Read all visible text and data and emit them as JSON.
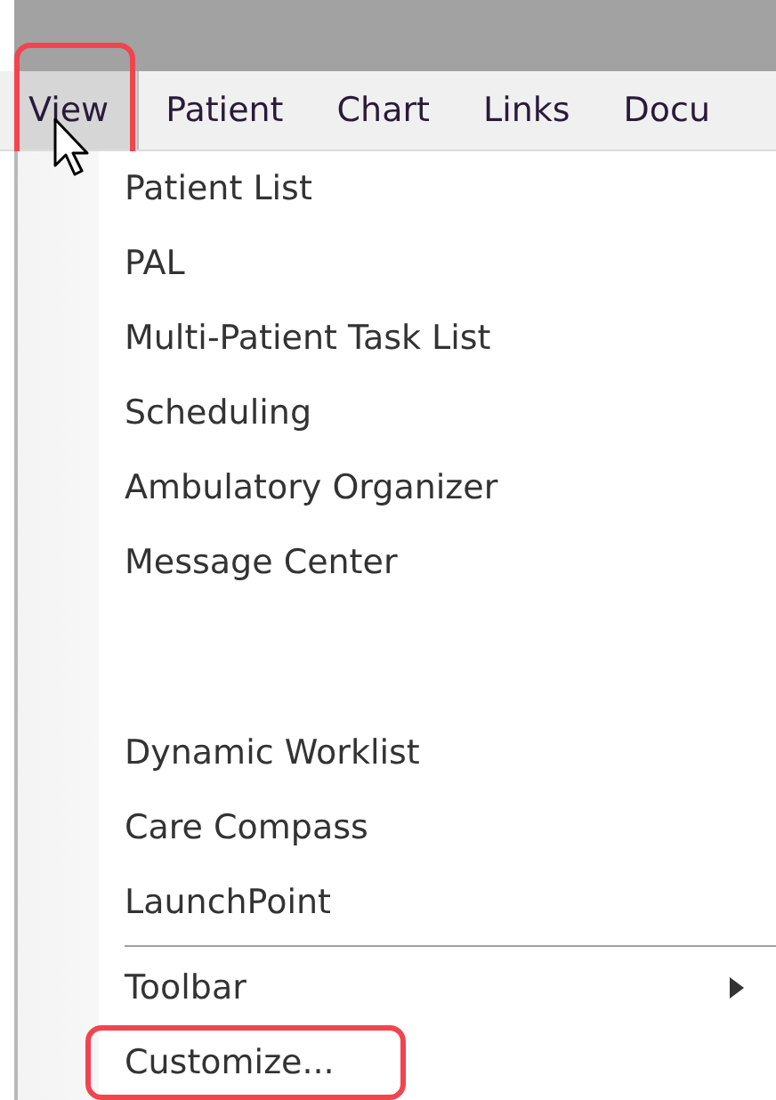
{
  "menubar": [
    {
      "label": "View",
      "selected": true,
      "highlighted": true
    },
    {
      "label": "Patient",
      "selected": false,
      "highlighted": false
    },
    {
      "label": "Chart",
      "selected": false,
      "highlighted": false
    },
    {
      "label": "Links",
      "selected": false,
      "highlighted": false
    },
    {
      "label": "Docu",
      "selected": false,
      "highlighted": false
    }
  ],
  "menu": [
    {
      "kind": "item",
      "label": "Patient List",
      "highlighted": false
    },
    {
      "kind": "item",
      "label": "PAL",
      "highlighted": false
    },
    {
      "kind": "item",
      "label": "Multi-Patient Task List",
      "highlighted": false
    },
    {
      "kind": "item",
      "label": "Scheduling",
      "highlighted": false
    },
    {
      "kind": "item",
      "label": "Ambulatory Organizer",
      "highlighted": false
    },
    {
      "kind": "item",
      "label": "Message Center",
      "highlighted": false
    },
    {
      "kind": "gap"
    },
    {
      "kind": "item",
      "label": "Dynamic Worklist",
      "highlighted": false
    },
    {
      "kind": "item",
      "label": "Care Compass",
      "highlighted": false
    },
    {
      "kind": "item",
      "label": "LaunchPoint",
      "highlighted": false
    },
    {
      "kind": "separator"
    },
    {
      "kind": "submenu",
      "label": "Toolbar",
      "highlighted": false
    },
    {
      "kind": "item",
      "label": "Customize...",
      "highlighted": true
    }
  ]
}
